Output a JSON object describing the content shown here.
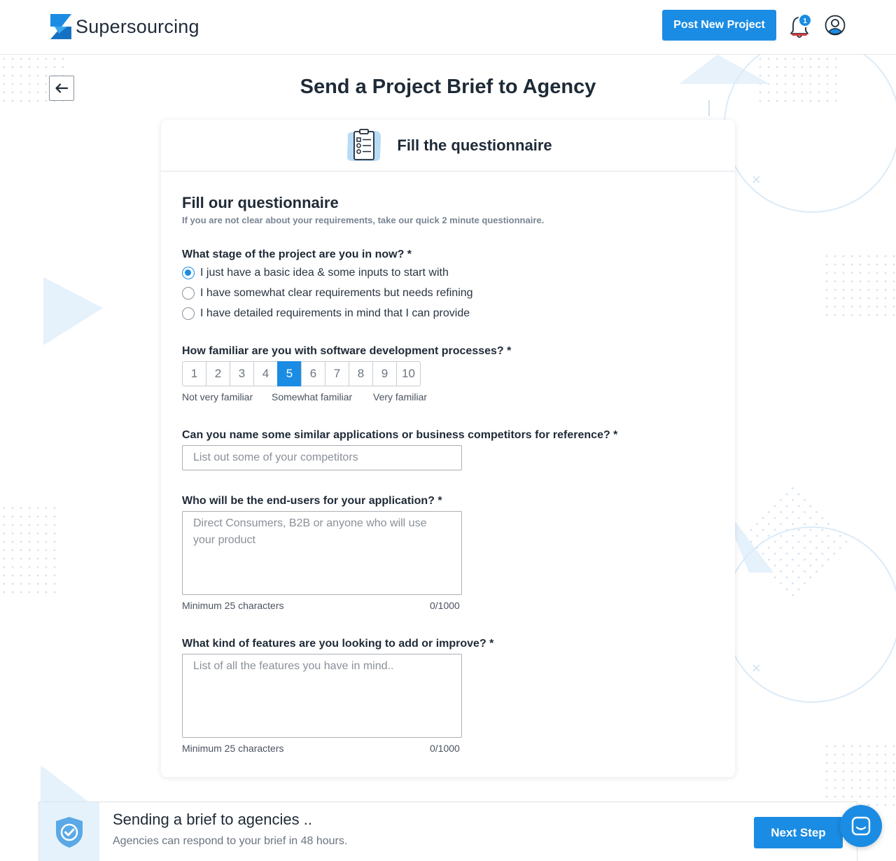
{
  "brand": {
    "name": "Supersourcing"
  },
  "header": {
    "post_button": "Post New Project",
    "notification_count": "1"
  },
  "page": {
    "title": "Send a Project Brief to Agency"
  },
  "card": {
    "header_title": "Fill the questionnaire",
    "section_title": "Fill our questionnaire",
    "section_subtitle": "If you are not clear about your requirements, take our quick 2 minute questionnaire."
  },
  "questions": {
    "stage": {
      "label": "What stage of the project are you in now? *",
      "options": [
        "I just have a basic idea & some inputs to start with",
        "I have somewhat clear requirements but needs refining",
        "I have detailed requirements in mind that I can provide"
      ],
      "selected_index": 0
    },
    "familiarity": {
      "label": "How familiar are you with software development processes? *",
      "options": [
        "1",
        "2",
        "3",
        "4",
        "5",
        "6",
        "7",
        "8",
        "9",
        "10"
      ],
      "selected": "5",
      "scale_labels": [
        "Not very familiar",
        "Somewhat familiar",
        "Very familiar"
      ]
    },
    "competitors": {
      "label": "Can you name some similar applications or business competitors for reference? *",
      "placeholder": "List out some of your competitors",
      "value": ""
    },
    "end_users": {
      "label": "Who will be the end-users for your application? *",
      "placeholder": "Direct Consumers, B2B or anyone who will use your product",
      "value": "",
      "hint": "Minimum 25 characters",
      "counter": "0/1000"
    },
    "features": {
      "label": "What kind of features are you looking to add or improve? *",
      "placeholder": "List of all the features you have in mind..",
      "value": "",
      "hint": "Minimum 25 characters",
      "counter": "0/1000"
    }
  },
  "bottom_bar": {
    "title": "Sending a brief to agencies ..",
    "subtitle": "Agencies can respond to your brief in 48 hours.",
    "next_button": "Next Step"
  },
  "colors": {
    "accent": "#1b8ce3",
    "text": "#1f2a37",
    "muted": "#7b8592"
  }
}
